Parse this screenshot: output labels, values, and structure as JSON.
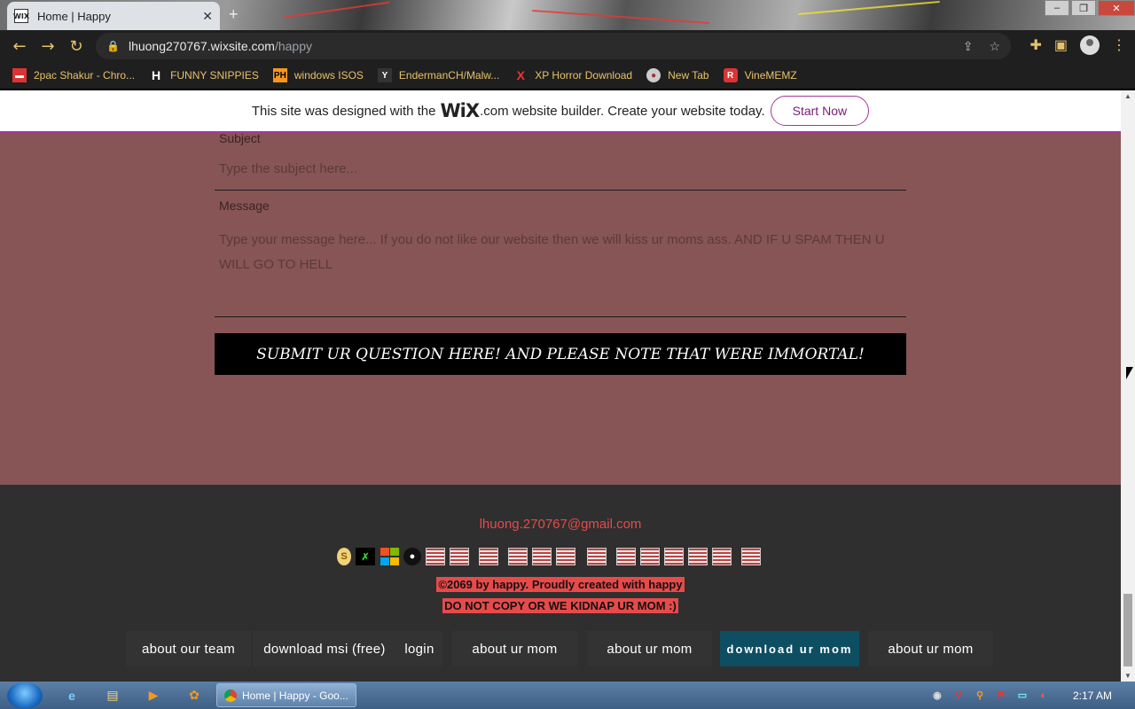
{
  "browser": {
    "tab_title": "Home | Happy",
    "tab_favicon": "WIX",
    "tab_close": "✕",
    "new_tab": "+",
    "url_host": "lhuong270767.wixsite.com",
    "url_path": "/happy"
  },
  "bookmarks": [
    {
      "label": "2pac Shakur - Chro...",
      "icon": "red-folder-icon"
    },
    {
      "label": "FUNNY SNIPPIES",
      "icon": "H"
    },
    {
      "label": "windows ISOS",
      "icon": "PH"
    },
    {
      "label": "EndermanCH/Malw...",
      "icon": "Y"
    },
    {
      "label": "XP Horror Download",
      "icon": "X"
    },
    {
      "label": "New Tab",
      "icon": "globe-icon"
    },
    {
      "label": "VineMEMZ",
      "icon": "R"
    }
  ],
  "wix_banner": {
    "text_before": "This site was designed with the",
    "logo": "WiX",
    "text_after": ".com website builder. Create your website today.",
    "button": "Start Now"
  },
  "form": {
    "subject_label": "Subject",
    "subject_placeholder": "Type the subject here...",
    "message_label": "Message",
    "message_placeholder": "Type your message here... If you do not like our website then we will kiss ur moms ass. AND IF U SPAM THEN U WILL GO TO HELL",
    "submit_label": "SUBMIT UR QUESTION HERE! AND PLEASE NOTE THAT WERE IMMORTAL!"
  },
  "footer": {
    "email": "lhuong.270767@gmail.com",
    "copyright": "©2069 by happy. Proudly created with happy",
    "warning": "DO NOT COPY OR WE KIDNAP UR MOM :)",
    "social_icons": [
      "s-icon",
      "x-icon",
      "windows-icon",
      "github-icon",
      "broken-image-icon",
      "broken-image-icon",
      "broken-image-icon",
      "broken-image-icon",
      "broken-image-icon",
      "broken-image-icon",
      "broken-image-icon",
      "broken-image-icon",
      "broken-image-icon",
      "broken-image-icon",
      "broken-image-icon",
      "broken-image-icon",
      "broken-image-icon"
    ],
    "nav": [
      {
        "label": "about our team"
      },
      {
        "label": "download msi (free)"
      },
      {
        "label": "login"
      },
      {
        "label": "about ur mom"
      },
      {
        "label": "about ur mom"
      },
      {
        "label": "download ur mom"
      },
      {
        "label": "about ur mom"
      }
    ]
  },
  "taskbar": {
    "app_label": "Home | Happy - Goo...",
    "clock": "2:17 AM"
  },
  "colors": {
    "page_bg": "#875555",
    "footer_bg": "#2f2f2f",
    "accent_red": "#e84a4a",
    "active_nav": "#0e4e62",
    "wix_purple": "#a6389a"
  }
}
